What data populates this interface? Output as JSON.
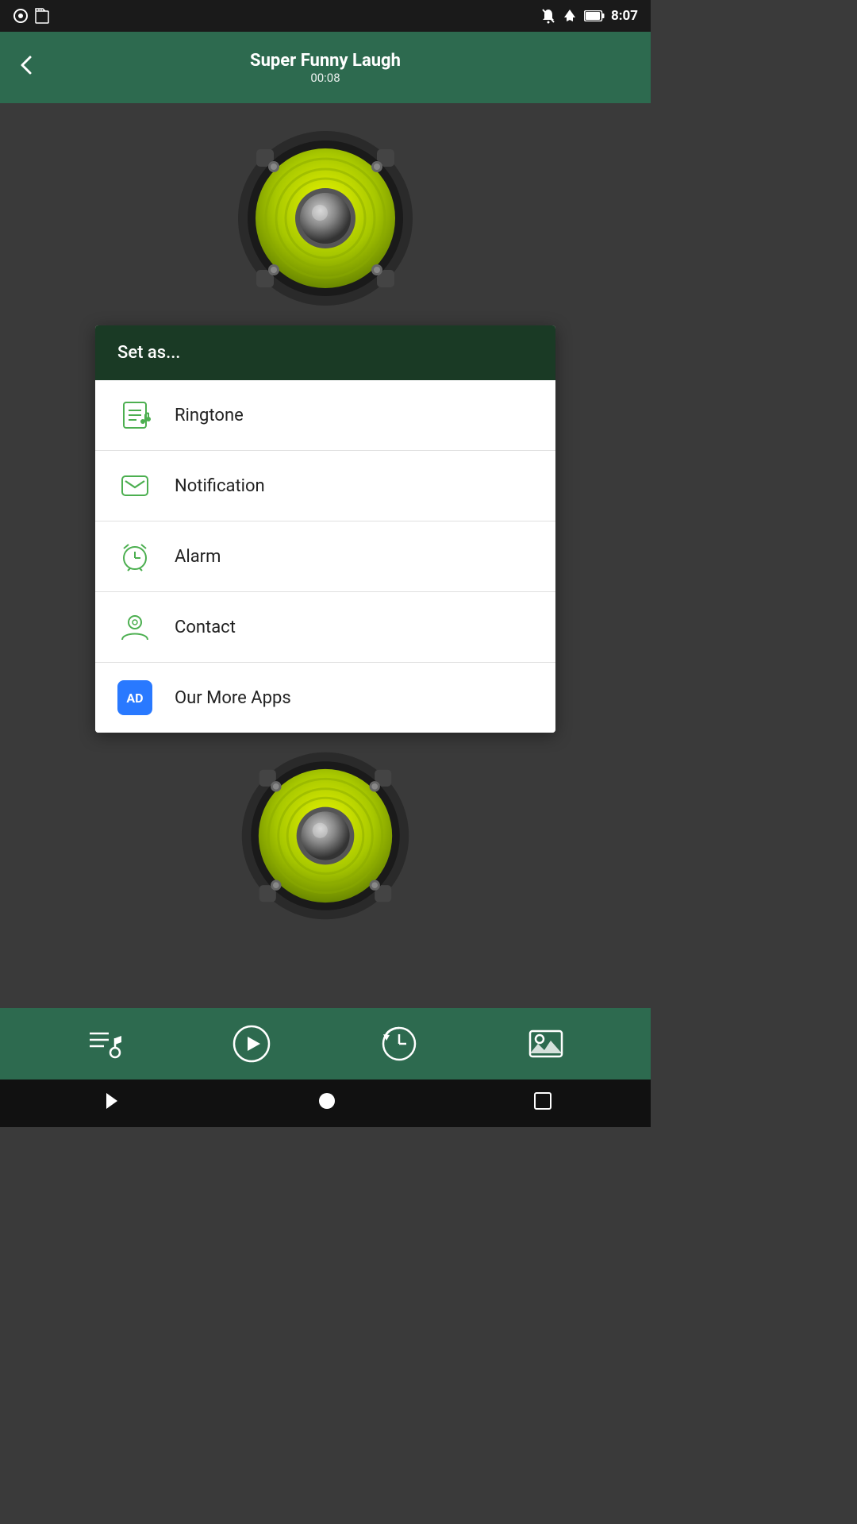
{
  "statusBar": {
    "time": "8:07",
    "icons": [
      "notification-off",
      "airplane",
      "battery"
    ]
  },
  "header": {
    "back_label": "‹",
    "title": "Super Funny Laugh",
    "duration": "00:08"
  },
  "menu": {
    "header_label": "Set as...",
    "items": [
      {
        "id": "ringtone",
        "label": "Ringtone",
        "icon": "ringtone-icon"
      },
      {
        "id": "notification",
        "label": "Notification",
        "icon": "notification-icon"
      },
      {
        "id": "alarm",
        "label": "Alarm",
        "icon": "alarm-icon"
      },
      {
        "id": "contact",
        "label": "Contact",
        "icon": "contact-icon"
      },
      {
        "id": "more-apps",
        "label": "Our More Apps",
        "icon": "ad-icon"
      }
    ]
  },
  "toolbar": {
    "buttons": [
      {
        "id": "playlist",
        "label": "Playlist"
      },
      {
        "id": "play",
        "label": "Play"
      },
      {
        "id": "history",
        "label": "History"
      },
      {
        "id": "wallpaper",
        "label": "Wallpaper"
      }
    ]
  },
  "colors": {
    "header_bg": "#2d6a4f",
    "menu_header_bg": "#1a3a25",
    "speaker_cone": "#c8e000",
    "ad_badge": "#2979ff",
    "green_icon": "#4caf50"
  }
}
